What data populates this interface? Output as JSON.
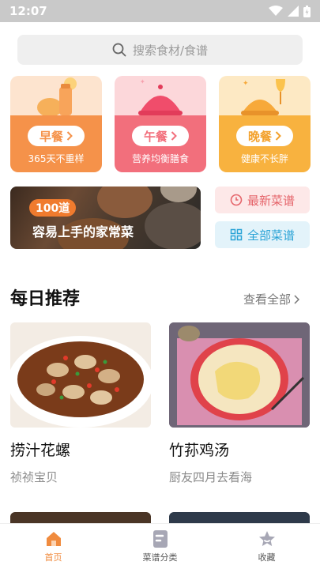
{
  "status_bar": {
    "time": "12:07"
  },
  "search": {
    "placeholder": "搜索食材/食谱"
  },
  "meals": [
    {
      "label": "早餐",
      "sub": "365天不重样",
      "color": "#f5924a",
      "light": "#fde4cf"
    },
    {
      "label": "午餐",
      "sub": "营养均衡膳食",
      "color": "#f26f7c",
      "light": "#fcd7da"
    },
    {
      "label": "晚餐",
      "sub": "健康不长胖",
      "color": "#f8b23f",
      "light": "#fde9c4"
    }
  ],
  "banner": {
    "tag": "100道",
    "title": "容易上手的家常菜"
  },
  "side_buttons": {
    "latest": {
      "label": "最新菜谱",
      "color": "#e5646a",
      "bg": "#fde8e8"
    },
    "all": {
      "label": "全部菜谱",
      "color": "#2aa3d6",
      "bg": "#e3f3fa"
    }
  },
  "daily": {
    "title": "每日推荐",
    "more": "查看全部",
    "recipes": [
      {
        "name": "捞汁花螺",
        "author": "祯祯宝贝"
      },
      {
        "name": "竹荪鸡汤",
        "author": "厨友四月去看海"
      }
    ]
  },
  "tabs": [
    {
      "label": "首页",
      "icon": "home-icon"
    },
    {
      "label": "菜谱分类",
      "icon": "recipe-book-icon"
    },
    {
      "label": "收藏",
      "icon": "star-icon"
    }
  ],
  "accent": "#f08b3e"
}
